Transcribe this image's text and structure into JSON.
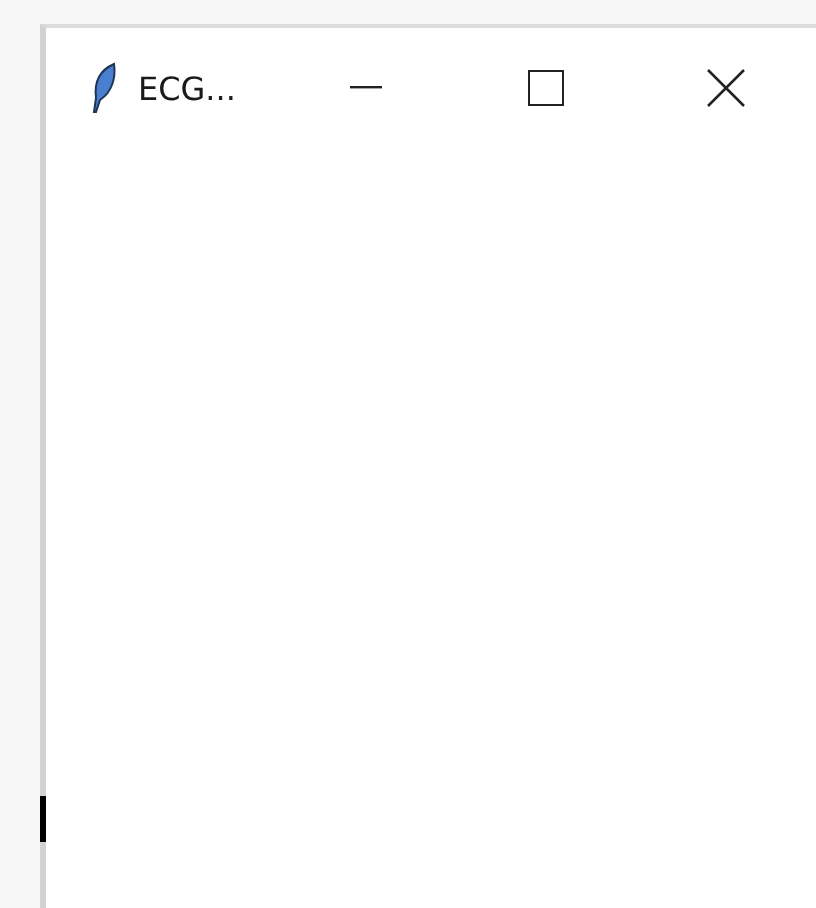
{
  "window": {
    "title": "ECG..."
  }
}
